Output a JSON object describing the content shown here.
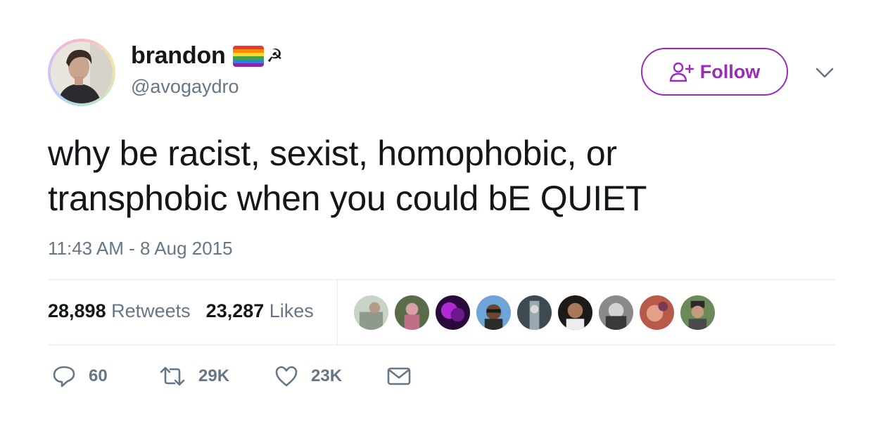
{
  "user": {
    "display_name": "brandon",
    "handle": "@avogaydro",
    "name_emoji": [
      "rainbow-flag",
      "hammer-and-sickle"
    ],
    "hammer_sickle_glyph": "☭"
  },
  "follow_button": {
    "label": "Follow",
    "icon": "add-user-icon",
    "color": "#9b2cbb"
  },
  "tweet": {
    "lines": [
      "why be racist, sexist, homophobic, or",
      "transphobic when you could bE QUIET"
    ],
    "timestamp": "11:43 AM - 8 Aug 2015"
  },
  "stats": {
    "retweets_count": "28,898",
    "retweets_label": "Retweets",
    "likes_count": "23,287",
    "likes_label": "Likes",
    "liker_avatar_count": 9
  },
  "actions": {
    "reply_count": "60",
    "retweet_count": "29K",
    "like_count": "23K"
  },
  "colors": {
    "text": "#14171a",
    "secondary": "#657786",
    "divider": "#e6ecf0",
    "accent": "#9b2cbb"
  }
}
